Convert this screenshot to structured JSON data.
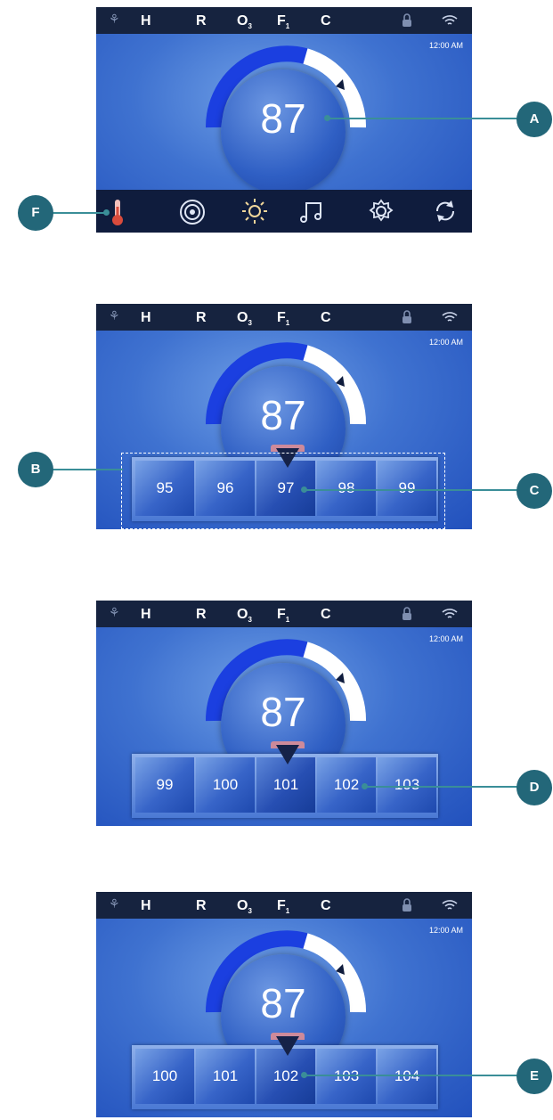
{
  "status_bar": {
    "indicators": [
      {
        "icon": "pump-icon"
      },
      {
        "label": "H"
      },
      {
        "label": "R"
      },
      {
        "label": "O",
        "sub": "3"
      },
      {
        "label": "F",
        "sub": "1"
      },
      {
        "label": "C"
      },
      {
        "icon": "lock-icon"
      },
      {
        "icon": "wifi-icon"
      }
    ]
  },
  "time": "12:00 AM",
  "set_temperature": "87",
  "nav_icons": [
    "thermometer-icon",
    "jets-icon",
    "light-icon",
    "music-icon",
    "settings-icon",
    "cycle-icon"
  ],
  "screens": [
    {
      "picker": null
    },
    {
      "picker": [
        "95",
        "96",
        "97",
        "98",
        "99"
      ]
    },
    {
      "picker": [
        "99",
        "100",
        "101",
        "102",
        "103"
      ]
    },
    {
      "picker": [
        "100",
        "101",
        "102",
        "103",
        "104"
      ]
    }
  ],
  "callouts": {
    "a": "A",
    "b": "B",
    "c": "C",
    "d": "D",
    "e": "E",
    "f": "F"
  },
  "colors": {
    "screen_blue": "#2f62c9",
    "status_bar": "#16233f",
    "gauge_heat": "#1b3fe0",
    "callout_badge": "#236779",
    "leader_line": "#3a8e98"
  }
}
